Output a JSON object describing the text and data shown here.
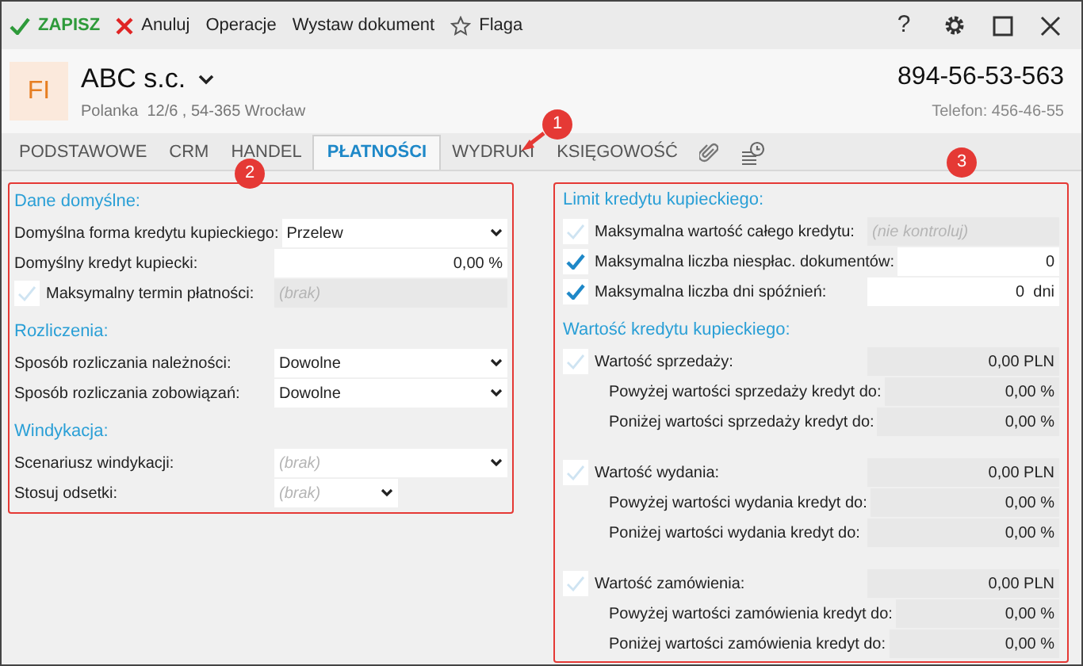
{
  "toolbar": {
    "items": [
      {
        "kind": "save",
        "label": "ZAPISZ"
      },
      {
        "kind": "cancel",
        "label": "Anuluj"
      },
      {
        "kind": "plain",
        "label": "Operacje"
      },
      {
        "kind": "plain",
        "label": "Wystaw dokument"
      },
      {
        "kind": "flag",
        "label": "Flaga"
      }
    ],
    "help": "?"
  },
  "header": {
    "avatar": "FI",
    "name": "ABC s.c.",
    "address": "Polanka  12/6 , 54-365 Wrocław",
    "nip": "894-56-53-563",
    "phone": "Telefon: 456-46-55"
  },
  "tabs": [
    {
      "kind": "text",
      "label": "PODSTAWOWE",
      "selected": false
    },
    {
      "kind": "text",
      "label": "CRM",
      "selected": false
    },
    {
      "kind": "text",
      "label": "HANDEL",
      "selected": false
    },
    {
      "kind": "text",
      "label": "PŁATNOŚCI",
      "selected": true
    },
    {
      "kind": "text",
      "label": "WYDRUKI",
      "selected": false
    },
    {
      "kind": "text",
      "label": "KSIĘGOWOŚĆ",
      "selected": false
    },
    {
      "kind": "attachment",
      "selected": false
    },
    {
      "kind": "history",
      "selected": false
    }
  ],
  "annotations": [
    {
      "label": "1"
    },
    {
      "label": "2"
    },
    {
      "label": "3"
    }
  ],
  "left_panel": {
    "highlighted": true,
    "sections": [
      {
        "title": "Dane domyślne:",
        "rows": [
          {
            "kind": "plain",
            "label": "Domyślna forma kredytu kupieckiego:",
            "field": {
              "kind": "select",
              "value": "Przelew",
              "disabled": false
            }
          },
          {
            "kind": "plain",
            "label": "Domyślny kredyt kupiecki:",
            "field": {
              "kind": "number",
              "value": "0,00 %",
              "disabled": false
            }
          },
          {
            "kind": "check",
            "label": "Maksymalny termin płatności:",
            "checked": false,
            "field": {
              "kind": "text",
              "placeholder": "(brak)",
              "disabled": true
            }
          }
        ]
      },
      {
        "title": "Rozliczenia:",
        "rows": [
          {
            "kind": "plain",
            "label": "Sposób rozliczania należności:",
            "field": {
              "kind": "select",
              "value": "Dowolne",
              "disabled": false
            }
          },
          {
            "kind": "plain",
            "label": "Sposób rozliczania zobowiązań:",
            "field": {
              "kind": "select",
              "value": "Dowolne",
              "disabled": false
            }
          }
        ]
      },
      {
        "title": "Windykacja:",
        "rows": [
          {
            "kind": "plain",
            "label": "Scenariusz windykacji:",
            "field": {
              "kind": "select",
              "placeholder": "(brak)",
              "disabled": false
            }
          },
          {
            "kind": "plain",
            "label": "Stosuj odsetki:",
            "field": {
              "kind": "short_select",
              "placeholder": "(brak)",
              "disabled": false
            }
          }
        ]
      }
    ]
  },
  "right_panel": {
    "highlighted": true,
    "sections": [
      {
        "title": "Limit kredytu kupieckiego:",
        "rows": [
          {
            "kind": "check",
            "label": "Maksymalna wartość całego kredytu:",
            "checked": false,
            "field": {
              "kind": "text",
              "placeholder": "(nie kontroluj)",
              "disabled": true
            }
          },
          {
            "kind": "check",
            "label": "Maksymalna liczba niespłac. dokumentów:",
            "checked": true,
            "field": {
              "kind": "number",
              "value": "0",
              "disabled": false
            }
          },
          {
            "kind": "check",
            "label": "Maksymalna liczba dni spóźnień:",
            "checked": true,
            "field": {
              "kind": "number",
              "value": "0  dni",
              "disabled": false
            }
          }
        ]
      },
      {
        "title": "Wartość kredytu kupieckiego:",
        "rows": [
          {
            "kind": "check",
            "label": "Wartość sprzedaży:",
            "checked": false,
            "field": {
              "kind": "number",
              "value": "0,00 PLN",
              "disabled": true
            },
            "children": [
              {
                "kind": "plain",
                "label": "Powyżej wartości sprzedaży kredyt do:",
                "field": {
                  "kind": "number",
                  "value": "0,00 %",
                  "disabled": true
                }
              },
              {
                "kind": "plain",
                "label": "Poniżej wartości sprzedaży kredyt do:",
                "field": {
                  "kind": "number",
                  "value": "0,00 %",
                  "disabled": true
                }
              }
            ]
          },
          {
            "kind": "check",
            "label": "Wartość wydania:",
            "checked": false,
            "field": {
              "kind": "number",
              "value": "0,00 PLN",
              "disabled": true
            },
            "children": [
              {
                "kind": "plain",
                "label": "Powyżej wartości wydania kredyt do:",
                "field": {
                  "kind": "number",
                  "value": "0,00 %",
                  "disabled": true
                }
              },
              {
                "kind": "plain",
                "label": "Poniżej wartości wydania kredyt do:",
                "field": {
                  "kind": "number",
                  "value": "0,00 %",
                  "disabled": true
                }
              }
            ]
          },
          {
            "kind": "check",
            "label": "Wartość zamówienia:",
            "checked": false,
            "field": {
              "kind": "number",
              "value": "0,00 PLN",
              "disabled": true
            },
            "children": [
              {
                "kind": "plain",
                "label": "Powyżej wartości zamówienia kredyt do:",
                "field": {
                  "kind": "number",
                  "value": "0,00 %",
                  "disabled": true
                }
              },
              {
                "kind": "plain",
                "label": "Poniżej wartości zamówienia kredyt do:",
                "field": {
                  "kind": "number",
                  "value": "0,00 %",
                  "disabled": true
                }
              }
            ]
          }
        ]
      }
    ]
  }
}
